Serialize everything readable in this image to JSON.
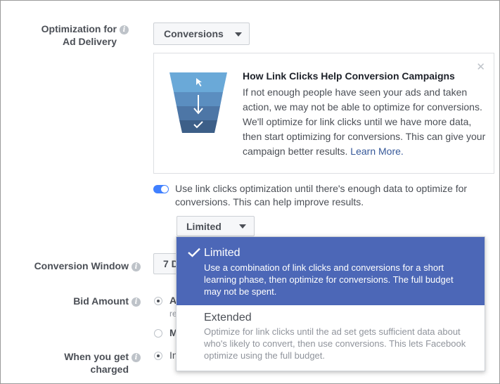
{
  "optimization": {
    "label_line1": "Optimization for",
    "label_line2": "Ad Delivery",
    "value": "Conversions"
  },
  "info_card": {
    "title": "How Link Clicks Help Conversion Campaigns",
    "body": "If not enough people have seen your ads and taken action, we may not be able to optimize for conversions. We'll optimize for link clicks until we have more data, then start optimizing for conversions. This can give your campaign better results.",
    "link": "Learn More."
  },
  "toggle": {
    "on": true,
    "text": "Use link clicks optimization until there's enough data to optimize for conversions. This can help improve results."
  },
  "dropdown": {
    "selected": "Limited",
    "options": [
      {
        "title": "Limited",
        "description": "Use a combination of link clicks and conversions for a short learning phase, then optimize for conversions. The full budget may not be spent."
      },
      {
        "title": "Extended",
        "description": "Optimize for link clicks until the ad set gets sufficient data about who's likely to convert, then use conversions. This lets Facebook optimize using the full budget."
      }
    ]
  },
  "conversion_window": {
    "label": "Conversion Window",
    "value_fragment": "7 D"
  },
  "bid_amount": {
    "label": "Bid Amount",
    "option1_fragment": "A",
    "option1_sub_fragment": "re",
    "option2_fragment": "M"
  },
  "charged": {
    "label_line1": "When you get",
    "label_line2": "charged",
    "option_fragment": "In"
  },
  "colors": {
    "accent": "#4080ff",
    "selected_option_bg": "#4c67b7",
    "link": "#365899"
  }
}
